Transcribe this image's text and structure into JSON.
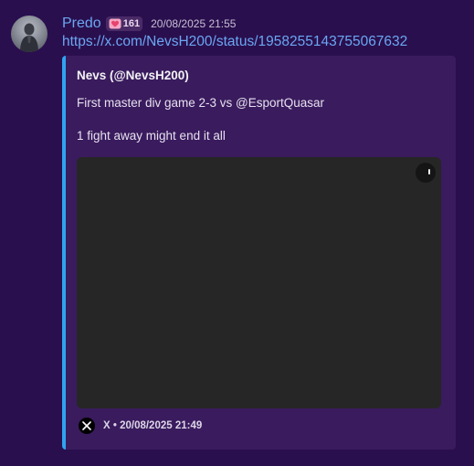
{
  "message": {
    "username": "Predo",
    "badge_count": "161",
    "badge_icon": "heart-icon",
    "timestamp": "20/08/2025 21:55",
    "link": "https://x.com/NevsH200/status/1958255143755067632"
  },
  "embed": {
    "author": "Nevs (@NevsH200)",
    "description_lines": [
      "First master div game 2-3 vs @EsportQuasar",
      "1 fight away might end it all"
    ],
    "media_icon": "loading-icon",
    "footer_icon": "x-logo-icon",
    "footer_text": "X • 20/08/2025 21:49"
  },
  "colors": {
    "background": "#2a0f4e",
    "username": "#6aa7f3",
    "link": "#6aa7f3",
    "embed_bar": "#2fa3f0",
    "embed_bg": "#3a1b5e",
    "media_bg": "#262626"
  }
}
